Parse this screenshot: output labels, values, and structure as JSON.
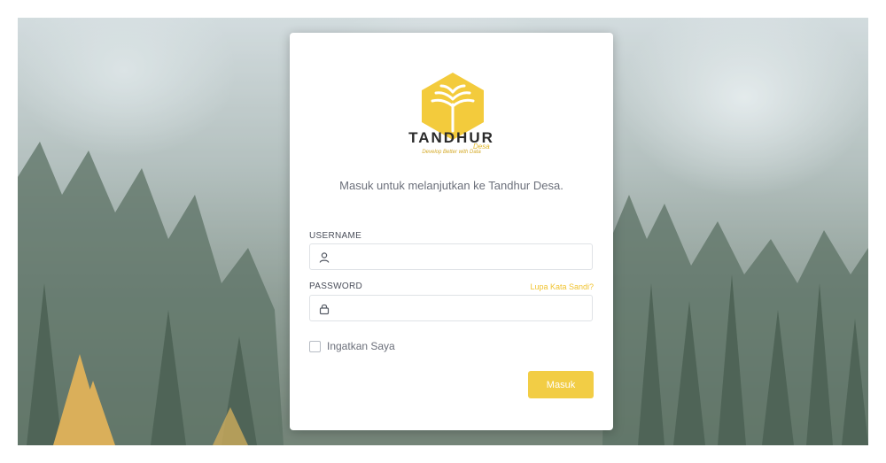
{
  "colors": {
    "accent": "#f2cd45",
    "logo_gold": "#f3cb3c",
    "link": "#f0c330"
  },
  "brand": {
    "name": "TANDHUR",
    "sub": "Desa",
    "tagline": "Develop Better with Data"
  },
  "login": {
    "subtitle": "Masuk untuk melanjutkan ke Tandhur Desa.",
    "username_label": "USERNAME",
    "username_value": "",
    "password_label": "PASSWORD",
    "password_value": "",
    "forgot_label": "Lupa Kata Sandi?",
    "remember_label": "Ingatkan Saya",
    "submit_label": "Masuk"
  },
  "icons": {
    "username": "user-icon",
    "password": "lock-icon"
  }
}
